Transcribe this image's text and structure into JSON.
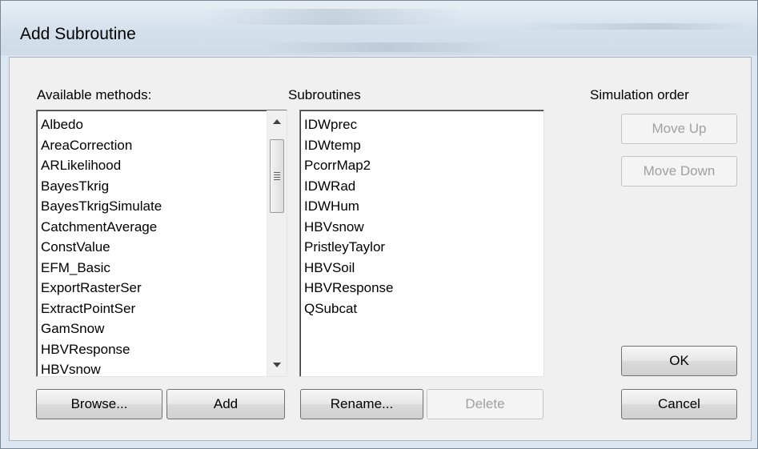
{
  "window": {
    "title": "Add Subroutine"
  },
  "available": {
    "label": "Available methods:",
    "items": [
      "Albedo",
      "AreaCorrection",
      "ARLikelihood",
      "BayesTkrig",
      "BayesTkrigSimulate",
      "CatchmentAverage",
      "ConstValue",
      "EFM_Basic",
      "ExportRasterSer",
      "ExtractPointSer",
      "GamSnow",
      "HBVResponse",
      "HBVsnow"
    ],
    "browse_label": "Browse...",
    "add_label": "Add"
  },
  "subroutines": {
    "label": "Subroutines",
    "items": [
      "IDWprec",
      "IDWtemp",
      "PcorrMap2",
      "IDWRad",
      "IDWHum",
      "HBVsnow",
      "PristleyTaylor",
      "HBVSoil",
      "HBVResponse",
      "QSubcat"
    ],
    "rename_label": "Rename...",
    "delete_label": "Delete"
  },
  "order": {
    "label": "Simulation order",
    "move_up_label": "Move Up",
    "move_down_label": "Move Down"
  },
  "dialog": {
    "ok_label": "OK",
    "cancel_label": "Cancel"
  },
  "icons": {
    "scroll_up": "scroll-up-arrow-icon",
    "scroll_down": "scroll-down-arrow-icon",
    "thumb_grip": "grip-icon"
  },
  "colors": {
    "window_bg": "#dce6f0",
    "client_bg": "#f0f0f0",
    "disabled_text": "#a0a0a0"
  }
}
